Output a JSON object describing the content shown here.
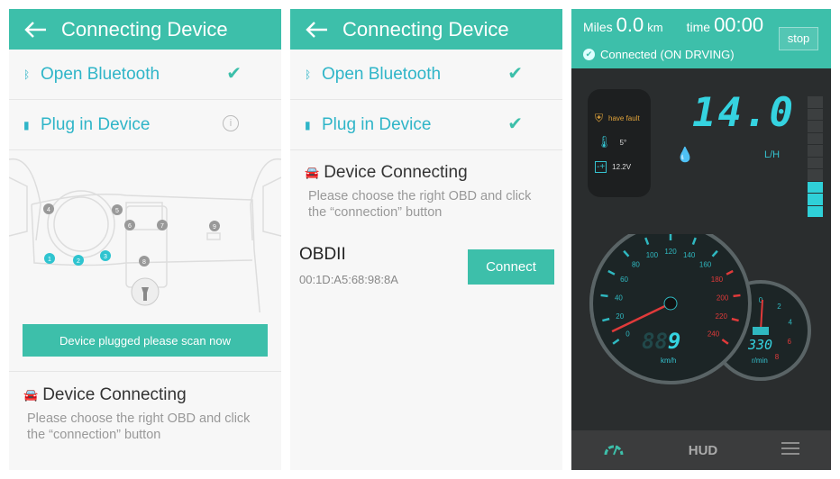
{
  "screen1": {
    "header": {
      "title": "Connecting Device",
      "back_icon": "arrow-left-icon"
    },
    "steps": [
      {
        "label": "Open Bluetooth",
        "icon": "bluetooth-icon",
        "status": "done"
      },
      {
        "label": "Plug in Device",
        "icon": "plug-icon",
        "status": "info"
      }
    ],
    "diagram": {
      "highlighted_ports": [
        "1",
        "2",
        "3"
      ],
      "other_ports": [
        "4",
        "5",
        "6",
        "7",
        "8",
        "9"
      ]
    },
    "scan_button": "Device plugged please scan now",
    "device_connecting": {
      "title": "Device Connecting",
      "hint": "Please choose the right OBD and click the “connection” button"
    }
  },
  "screen2": {
    "header": {
      "title": "Connecting Device"
    },
    "steps": [
      {
        "label": "Open Bluetooth",
        "status": "done"
      },
      {
        "label": "Plug in Device",
        "status": "done"
      }
    ],
    "device_connecting": {
      "title": "Device Connecting",
      "hint": "Please choose the right OBD and click the “connection” button"
    },
    "device": {
      "name": "OBDII",
      "address": "00:1D:A5:68:98:8A",
      "connect_label": "Connect"
    }
  },
  "screen3": {
    "miles_label": "Miles",
    "miles_value": "0.0",
    "miles_unit": "km",
    "time_label": "time",
    "time_value": "00:00",
    "stop_label": "stop",
    "status": "Connected (ON DRVING)",
    "fault": "have fault",
    "temp": "5°",
    "voltage": "12.2V",
    "fuel_rate": "14.0",
    "fuel_unit": "L/H",
    "fuel_level_segments": {
      "lit": 3,
      "total": 10
    },
    "speed_ticks": [
      "0",
      "20",
      "40",
      "60",
      "80",
      "100",
      "120",
      "140",
      "160",
      "180",
      "200",
      "220",
      "240"
    ],
    "speed_digits_dim": "88",
    "speed_value": "9",
    "speed_unit": "km/h",
    "rpm_ticks": [
      "0",
      "2",
      "4",
      "6",
      "8"
    ],
    "rpm_value": "330",
    "rpm_unit": "r/min",
    "nav": {
      "hud": "HUD"
    },
    "colors": {
      "accent": "#3dbfaa",
      "digit": "#35d3e0",
      "red": "#e03a3a",
      "fault": "#e0a33a"
    }
  }
}
